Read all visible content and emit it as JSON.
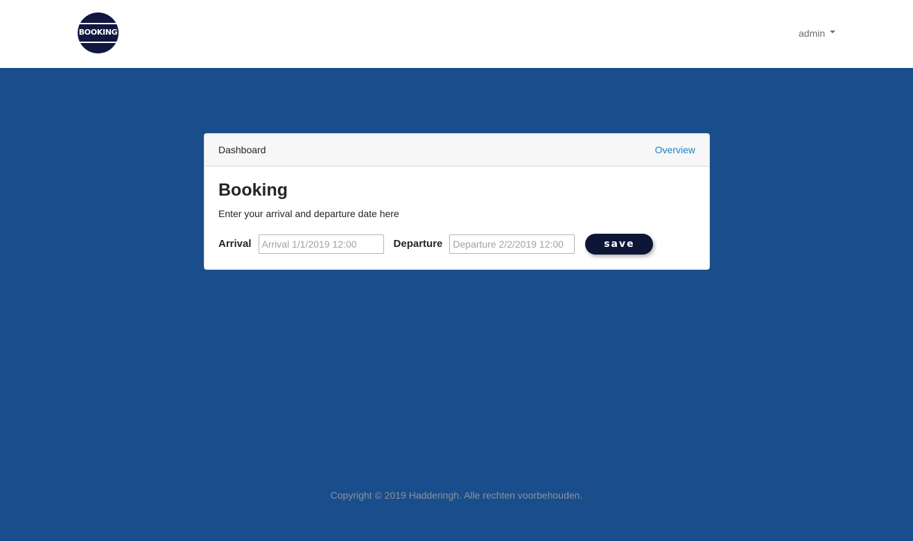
{
  "navbar": {
    "logo_text": "BOOKING",
    "user_menu_label": "admin",
    "user_menu_icon": "caret-down-icon"
  },
  "card": {
    "header_title": "Dashboard",
    "overview_link": "Overview",
    "title": "Booking",
    "description": "Enter your arrival and departure date here",
    "form": {
      "arrival_label": "Arrival",
      "arrival_placeholder": "Arrival 1/1/2019 12:00",
      "arrival_value": "",
      "departure_label": "Departure",
      "departure_placeholder": "Departure 2/2/2019 12:00",
      "departure_value": "",
      "save_label": "save"
    }
  },
  "footer": {
    "copyright": "Copyright © 2019 Hadderingh. Alle rechten voorbehouden."
  },
  "colors": {
    "page_background": "#1a4d8b",
    "navbar_background": "#ffffff",
    "logo_background": "#101840",
    "save_button_background": "#0e1638",
    "link": "#1d82c5"
  }
}
